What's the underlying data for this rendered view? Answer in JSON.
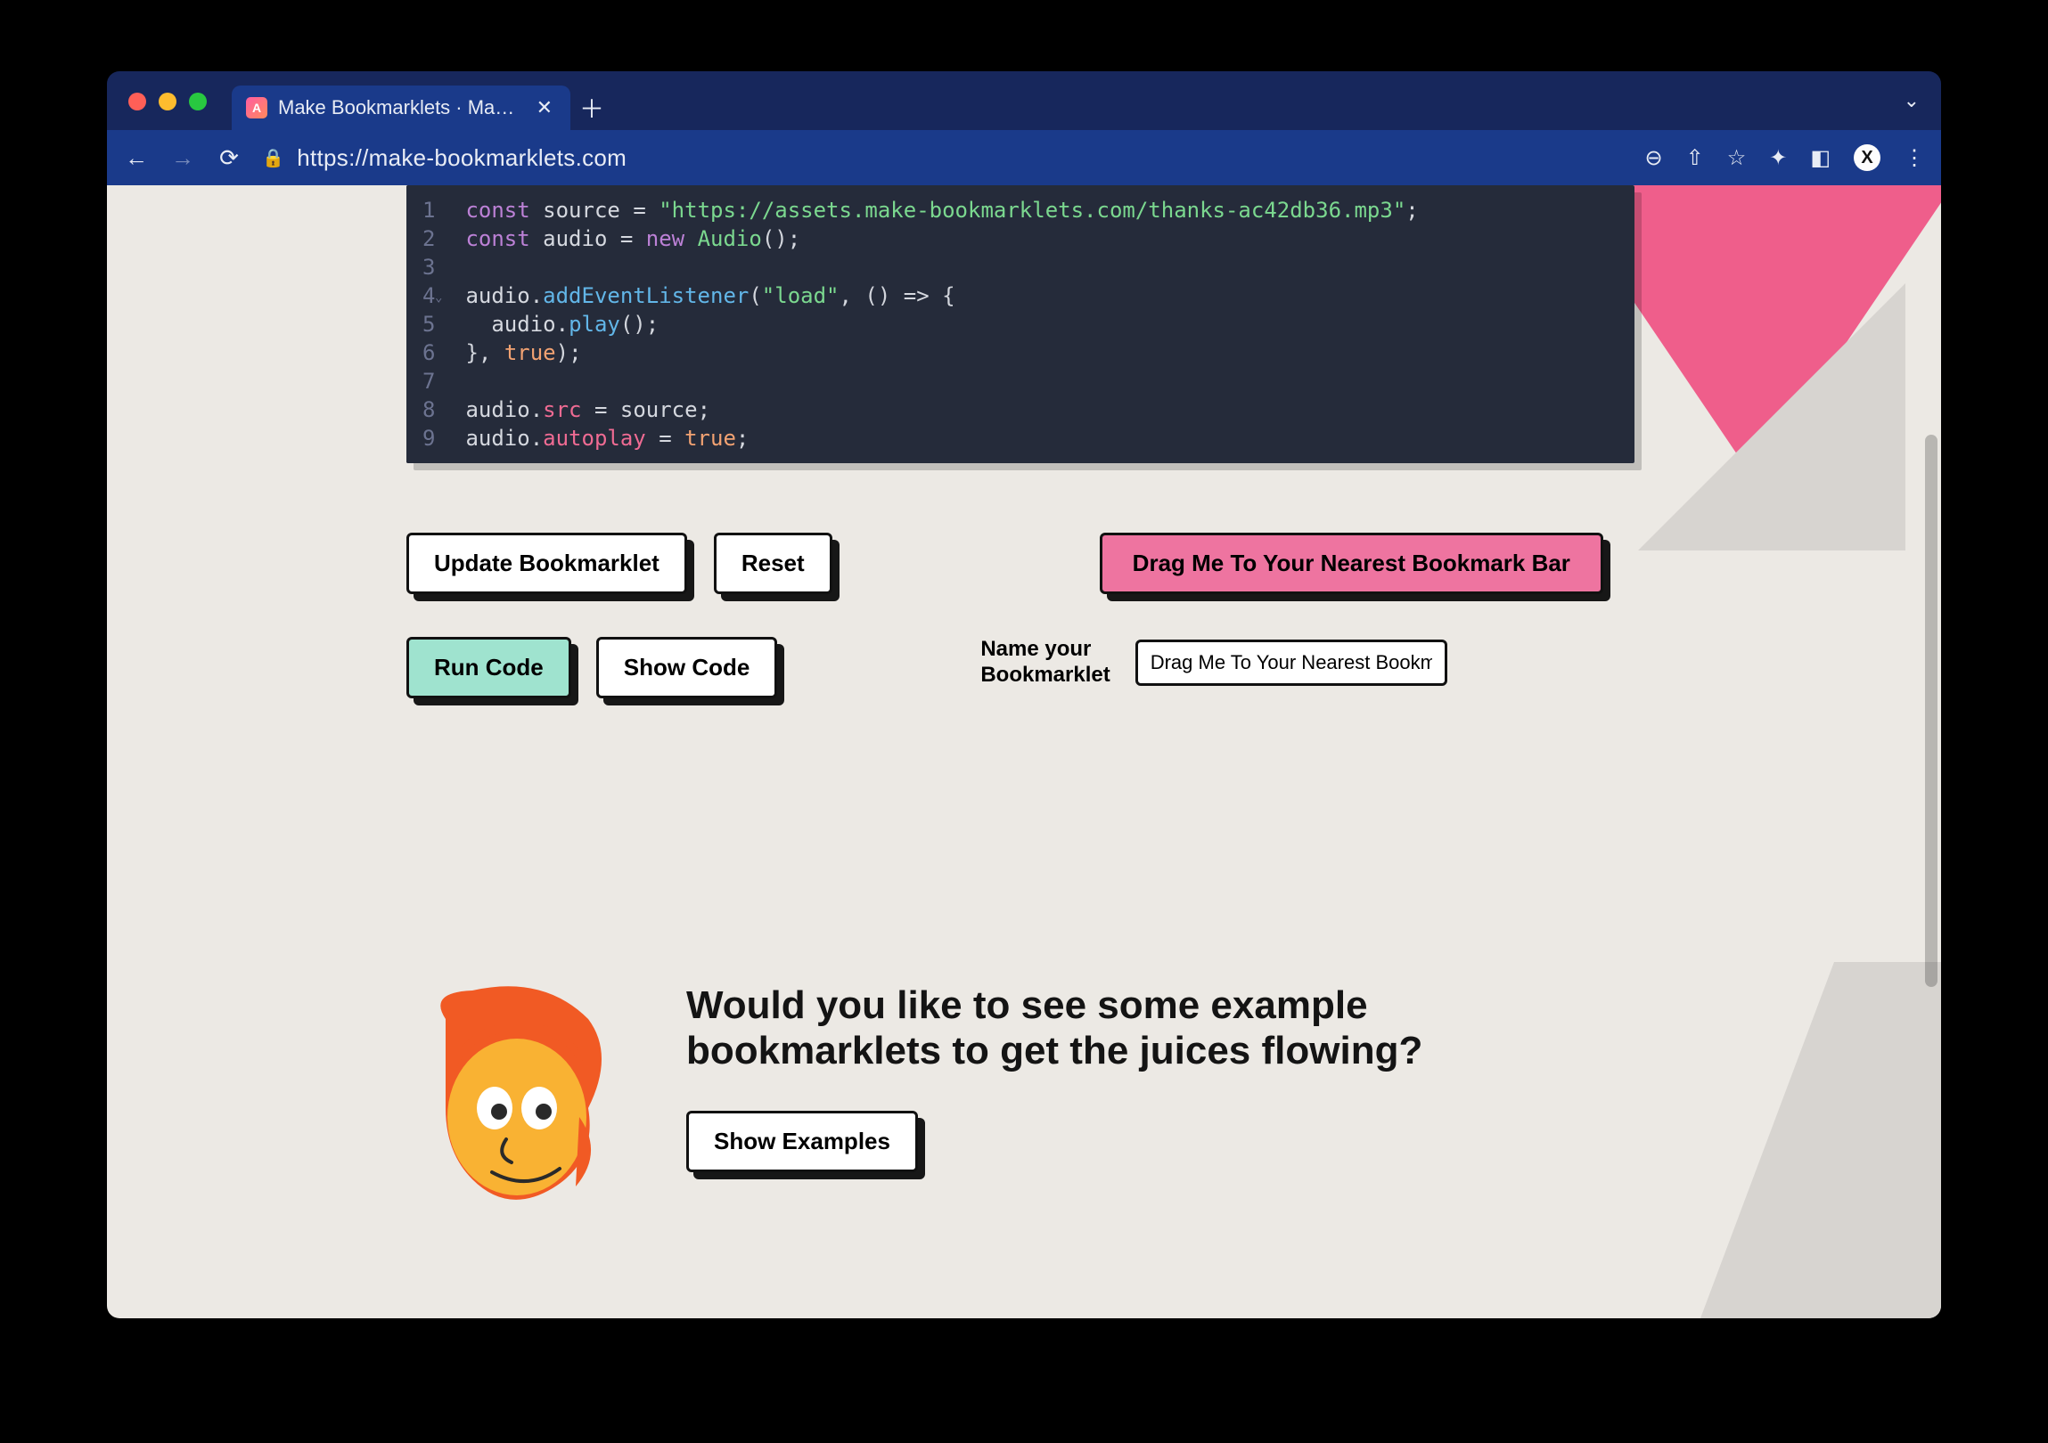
{
  "browser": {
    "tab_title": "Make Bookmarklets · Make it e",
    "url": "https://make-bookmarklets.com",
    "favicon_letter": "A",
    "avatar_letter": "X"
  },
  "code": {
    "lines": [
      "const source = \"https://assets.make-bookmarklets.com/thanks-ac42db36.mp3\";",
      "const audio = new Audio();",
      "",
      "audio.addEventListener(\"load\", () => {",
      "  audio.play();",
      "}, true);",
      "",
      "audio.src = source;",
      "audio.autoplay = true;"
    ],
    "line_count": 9
  },
  "buttons": {
    "update": "Update Bookmarklet",
    "reset": "Reset",
    "drag": "Drag Me To Your Nearest Bookmark Bar",
    "run": "Run Code",
    "show": "Show Code",
    "examples": "Show Examples"
  },
  "labels": {
    "name_your": "Name your Bookmarklet"
  },
  "inputs": {
    "name_value": "Drag Me To Your Nearest Bookmark"
  },
  "copy": {
    "examples_heading": "Would you like to see some example bookmarklets to get the juices flowing?"
  }
}
